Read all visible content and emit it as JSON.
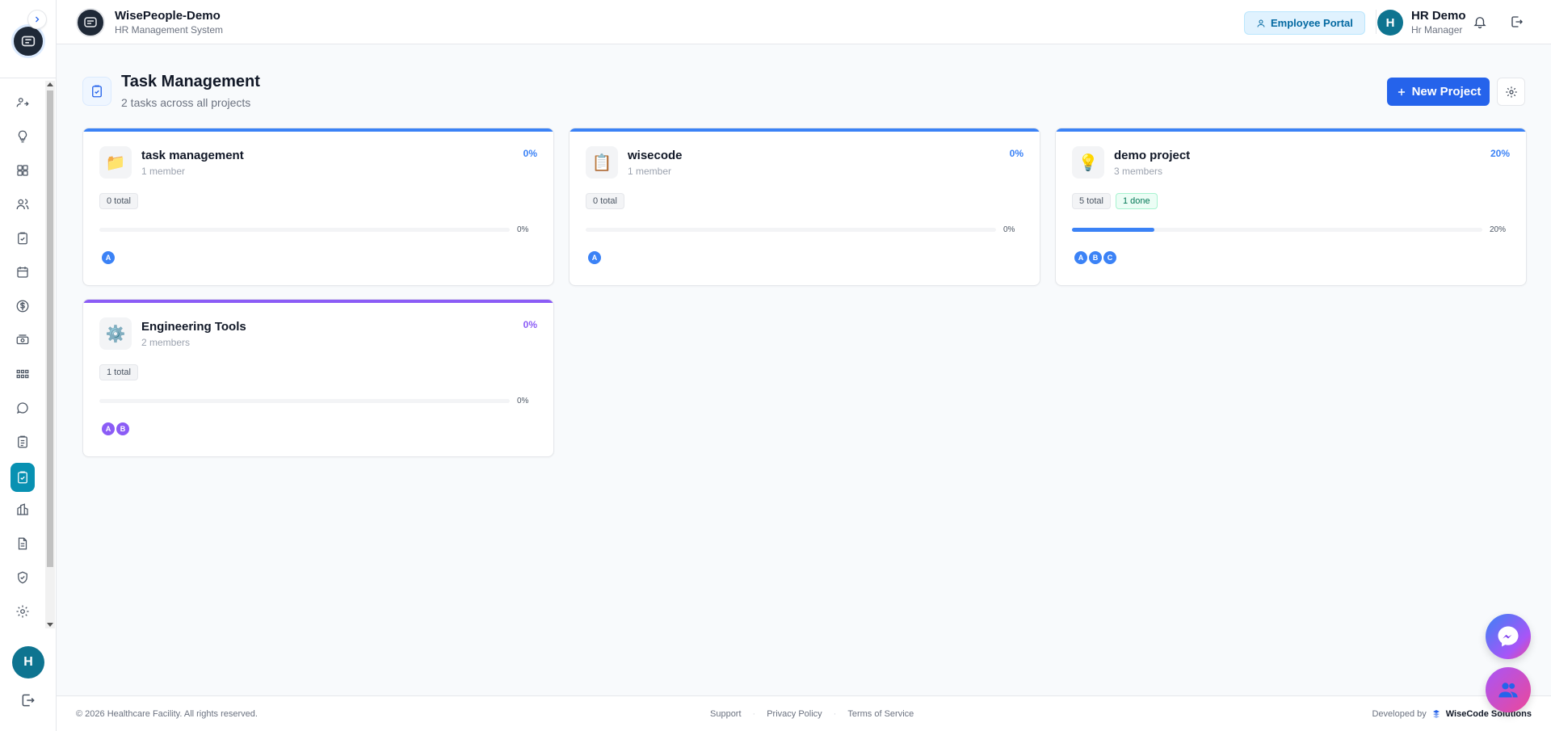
{
  "app": {
    "name": "WisePeople-Demo",
    "subtitle": "HR Management System"
  },
  "header": {
    "employee_portal_label": "Employee Portal",
    "user_initial": "H",
    "user_name": "HR Demo",
    "user_role": "Hr Manager"
  },
  "sidebar": {
    "avatar_initial": "H",
    "icons": [
      "user-switch-icon",
      "lightbulb-icon",
      "grid-icon",
      "users-icon",
      "clipboard-check-icon",
      "calendar-icon",
      "dollar-icon",
      "cash-icon",
      "org-chart-icon",
      "chat-icon",
      "clipboard-list-icon",
      "task-icon",
      "building-icon",
      "document-icon",
      "shield-icon",
      "settings-icon"
    ],
    "active_index": 11
  },
  "page": {
    "title": "Task Management",
    "subtitle": "2 tasks across all projects",
    "new_project_label": "New Project"
  },
  "projects": [
    {
      "name": "task management",
      "emoji": "📁",
      "members": "1 member",
      "percent_label": "0%",
      "progress": 0,
      "bar_label": "0%",
      "total_label": "0 total",
      "done_label": "",
      "color": "#3b82f6",
      "avatars": [
        "A"
      ]
    },
    {
      "name": "wisecode",
      "emoji": "📋",
      "members": "1 member",
      "percent_label": "0%",
      "progress": 0,
      "bar_label": "0%",
      "total_label": "0 total",
      "done_label": "",
      "color": "#3b82f6",
      "avatars": [
        "A"
      ]
    },
    {
      "name": "demo project",
      "emoji": "💡",
      "members": "3 members",
      "percent_label": "20%",
      "progress": 0.2,
      "bar_label": "20%",
      "total_label": "5 total",
      "done_label": "1 done",
      "color": "#3b82f6",
      "avatars": [
        "A",
        "B",
        "C"
      ]
    },
    {
      "name": "Engineering Tools",
      "emoji": "⚙️",
      "members": "2 members",
      "percent_label": "0%",
      "progress": 0,
      "bar_label": "0%",
      "total_label": "1 total",
      "done_label": "",
      "color": "#8b5cf6",
      "avatars": [
        "A",
        "B"
      ]
    }
  ],
  "footer": {
    "copyright": "© 2026 Healthcare Facility. All rights reserved.",
    "links": [
      "Support",
      "Privacy Policy",
      "Terms of Service"
    ],
    "developed_by": "Developed by",
    "developer": "WiseCode Solutions"
  }
}
